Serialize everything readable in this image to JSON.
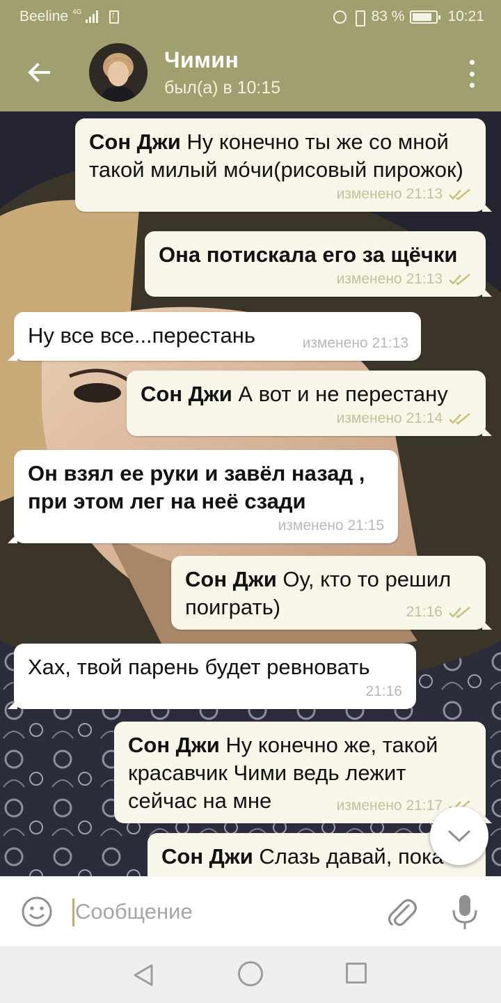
{
  "status_bar": {
    "carrier": "Beeline",
    "network": "4G",
    "battery": "83 %",
    "battery_level": 0.83,
    "time": "10:21"
  },
  "header": {
    "name": "Чимин",
    "status": "был(а) в 10:15",
    "back_icon": "arrow-left-icon",
    "menu_icon": "more-vertical-icon"
  },
  "messages": [
    {
      "dir": "out",
      "sender": "Сон Джи",
      "text": " Ну конечно ты же со мной такой милый мо́чи(рисовый пирожок)",
      "meta": "изменено 21:13"
    },
    {
      "dir": "out",
      "sender": "",
      "text": "Она потискала его за щёчки",
      "meta": "изменено 21:13"
    },
    {
      "dir": "in",
      "sender": "",
      "text": "Ну все все...перестань",
      "meta": "изменено 21:13"
    },
    {
      "dir": "out",
      "sender": "Сон Джи",
      "text": " А вот и не перестану",
      "meta": "изменено 21:14"
    },
    {
      "dir": "in",
      "sender": "",
      "text": "Он взял ее  руки и завёл назад , при этом лег на неё сзади",
      "meta": "изменено 21:15"
    },
    {
      "dir": "out",
      "sender": "Сон Джи",
      "text": " Оу, кто то решил поиграть)",
      "meta": "21:16"
    },
    {
      "dir": "in",
      "sender": "",
      "text": "Хах, твой парень будет ревновать",
      "meta": "21:16"
    },
    {
      "dir": "out",
      "sender": "Сон Джи",
      "text": " Ну конечно же, такой красавчик Чими ведь лежит сейчас на мне",
      "meta": "изменено 21:17"
    },
    {
      "dir": "out",
      "sender": "Сон Джи",
      "text": " Слазь давай, пока",
      "meta": ""
    }
  ],
  "composer": {
    "placeholder": "Сообщение",
    "emoji_icon": "emoji-icon",
    "attach_icon": "paperclip-icon",
    "mic_icon": "microphone-icon"
  },
  "colors": {
    "header_bg": "#a09f6f",
    "outgoing_bubble": "#f8f6e9",
    "incoming_bubble": "#ffffff",
    "meta_text": "#c4c09a",
    "caret": "#b9b464"
  }
}
